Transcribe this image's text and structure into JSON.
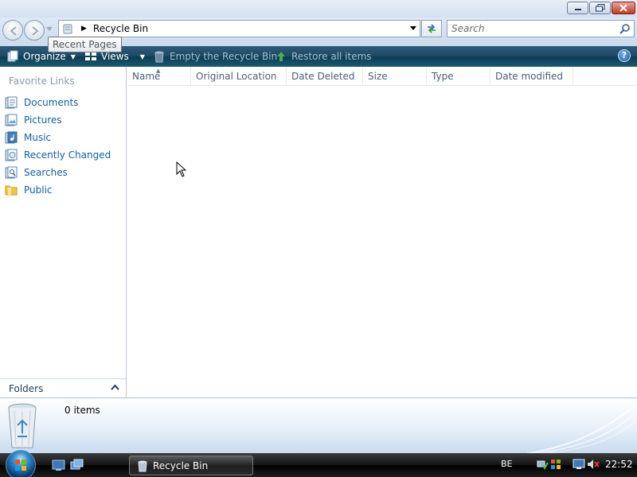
{
  "window": {
    "address_path": "Recycle Bin",
    "search_placeholder": "Search",
    "tooltip": "Recent Pages"
  },
  "commands": {
    "organize": "Organize",
    "views": "Views",
    "empty_bin": "Empty the Recycle Bin",
    "restore_all": "Restore all items"
  },
  "navpane": {
    "heading": "Favorite Links",
    "links": [
      "Documents",
      "Pictures",
      "Music",
      "Recently Changed",
      "Searches",
      "Public"
    ],
    "folders_label": "Folders"
  },
  "columns": [
    "Name",
    "Original Location",
    "Date Deleted",
    "Size",
    "Type",
    "Date modified"
  ],
  "details": {
    "items_count": "0 items"
  },
  "taskbar": {
    "task_label": "Recycle Bin",
    "language": "BE",
    "clock": "22:52"
  },
  "colors": {
    "command_bar": "#1c4963",
    "link": "#0f5fa8",
    "taskbar": "#141414"
  },
  "icons": [
    "back-icon",
    "forward-icon",
    "recycle-bin-icon",
    "refresh-icon",
    "search-icon",
    "organize-icon",
    "views-icon",
    "help-icon",
    "folder-icon",
    "start-orb-icon",
    "clock"
  ]
}
